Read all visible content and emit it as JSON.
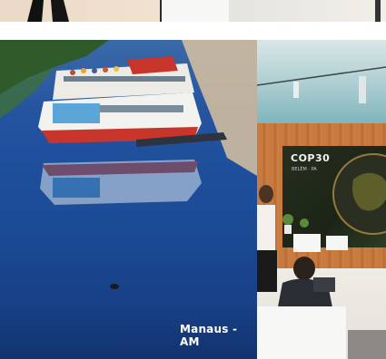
{
  "photo": {
    "poster_caption": "Manaus - AM",
    "booth_logo_text": "COP30",
    "booth_logo_subtext": "BELÉM · PA"
  },
  "colors": {
    "river_blue": "#1e4f9c",
    "boat_white": "#f2f2ee",
    "boat_red": "#c8352b",
    "booth_wood": "#c87a3f",
    "screen_dark": "#1b2416"
  }
}
